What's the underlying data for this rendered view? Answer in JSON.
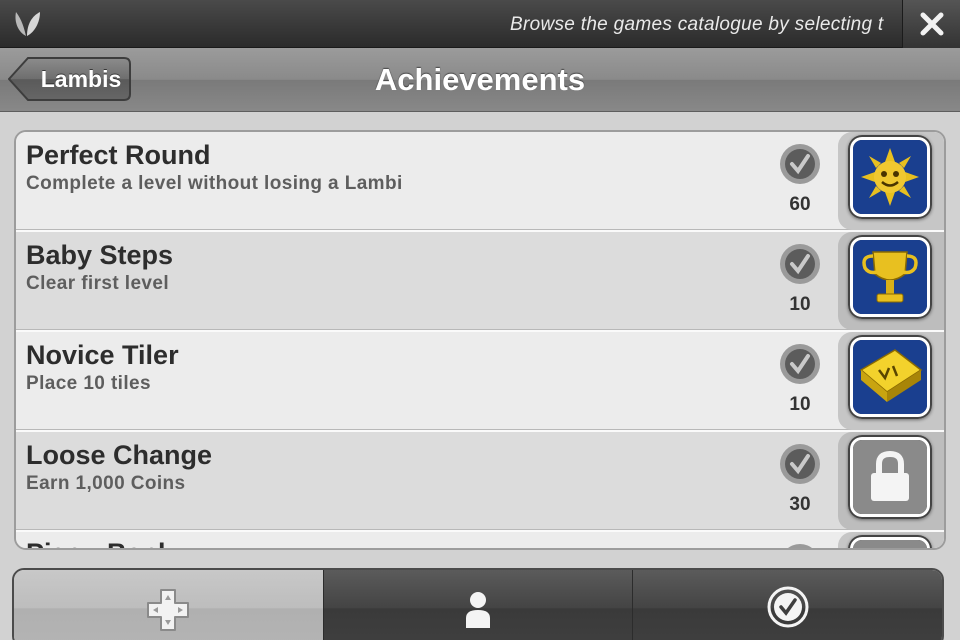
{
  "topbar": {
    "logo_icon": "leaf-logo-icon",
    "ticker_text": "Browse the games catalogue by selecting t",
    "close_icon": "close-icon"
  },
  "header": {
    "back_label": "Lambis",
    "title": "Achievements"
  },
  "achievements": [
    {
      "name": "Perfect Round",
      "description": "Complete a level without losing a Lambi",
      "points": "60",
      "badge_icon": "sun-face-badge-icon"
    },
    {
      "name": "Baby Steps",
      "description": "Clear first level",
      "points": "10",
      "badge_icon": "trophy-badge-icon"
    },
    {
      "name": "Novice Tiler",
      "description": "Place 10 tiles",
      "points": "10",
      "badge_icon": "tile-badge-icon"
    },
    {
      "name": "Loose Change",
      "description": "Earn 1,000 Coins",
      "points": "30",
      "badge_icon": "lock-icon"
    },
    {
      "name": "Piggy Bank",
      "description": "",
      "points": "",
      "badge_icon": "lock-icon"
    }
  ],
  "tabs": [
    {
      "name": "games-tab",
      "icon": "dpad-icon",
      "active": true
    },
    {
      "name": "profile-tab",
      "icon": "person-icon",
      "active": false
    },
    {
      "name": "achievements-tab",
      "icon": "achievement-check-icon",
      "active": false
    }
  ],
  "colors": {
    "badge_blue": "#1a3f8f",
    "gold": "#e8c020"
  }
}
